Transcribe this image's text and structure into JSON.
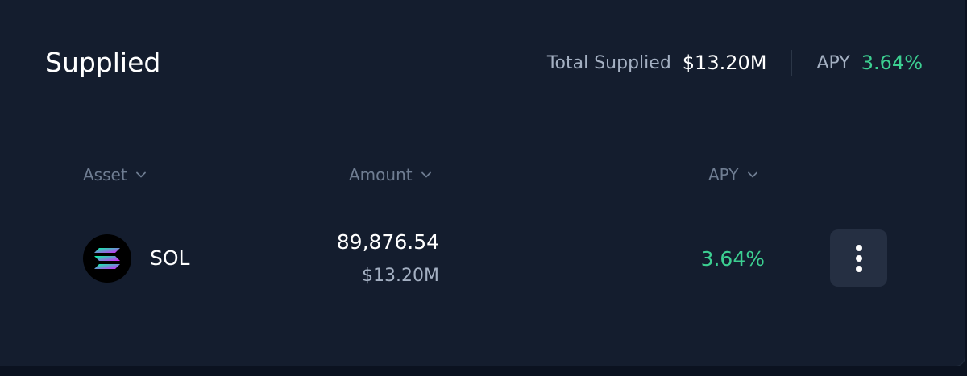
{
  "section": {
    "title": "Supplied"
  },
  "summary": {
    "total_label": "Total Supplied",
    "total_value": "$13.20M",
    "apy_label": "APY",
    "apy_value": "3.64%",
    "apy_color": "#3ccf91"
  },
  "table": {
    "columns": [
      {
        "label": "Asset",
        "icon": "chevron-down-icon"
      },
      {
        "label": "Amount",
        "icon": "chevron-down-icon"
      },
      {
        "label": "APY",
        "icon": "chevron-down-icon"
      }
    ],
    "rows": [
      {
        "asset_icon": "solana-logo-icon",
        "asset_symbol": "SOL",
        "amount": "89,876.54",
        "amount_usd": "$13.20M",
        "apy": "3.64%",
        "action_icon": "more-vertical-icon"
      }
    ]
  }
}
